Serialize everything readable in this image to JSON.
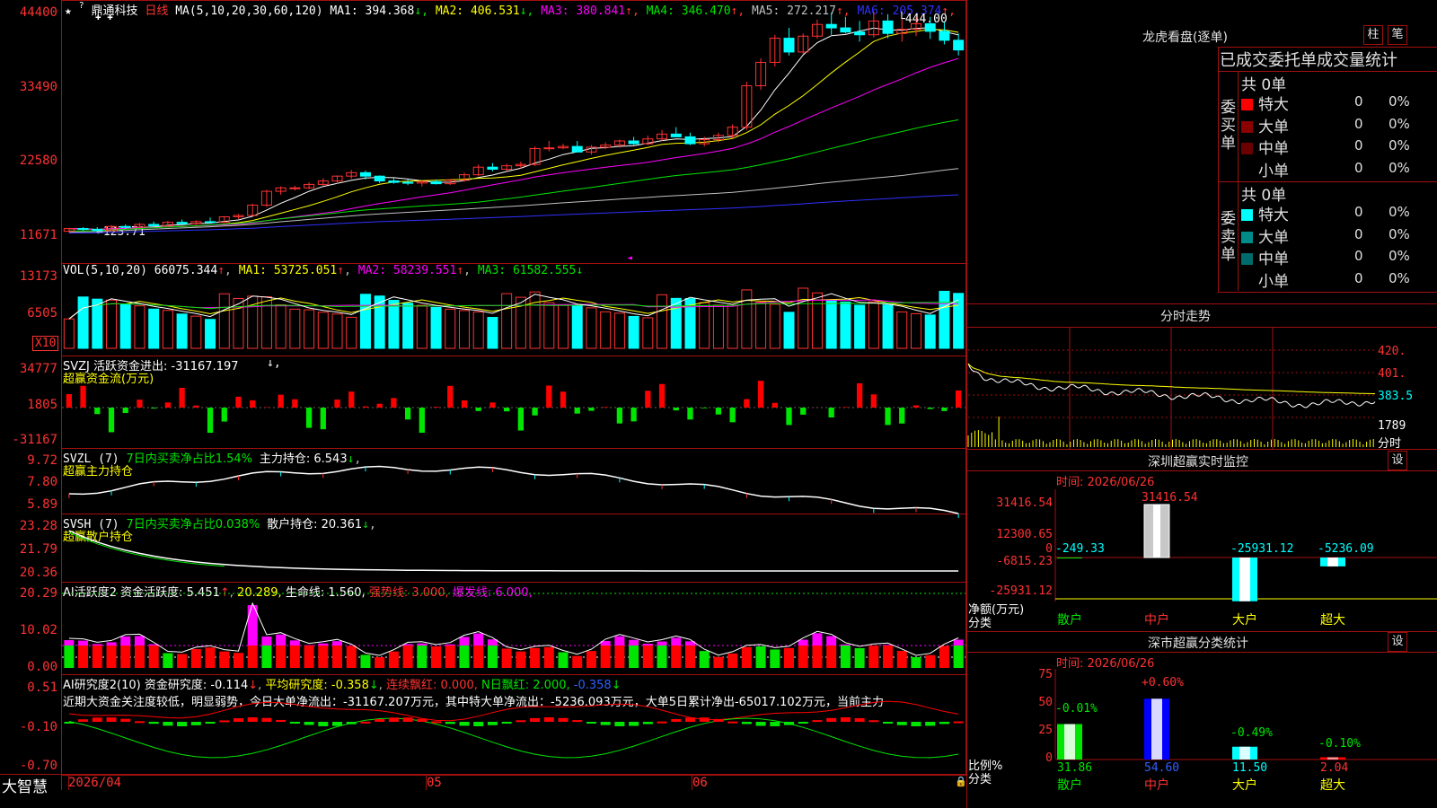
{
  "main": {
    "stock_name": "鼎通科技",
    "period": "日线",
    "ma_label": "MA(5,10,20,30,60,120)",
    "ma_values": [
      {
        "label": "MA1: 394.368",
        "arrow": "↓",
        "color": "#ffffff"
      },
      {
        "label": "MA2: 406.531",
        "arrow": "↓",
        "color": "#ffff00"
      },
      {
        "label": "MA3: 380.841",
        "arrow": "↑",
        "color": "#ff00ff"
      },
      {
        "label": "MA4: 346.470",
        "arrow": "↑",
        "color": "#00e600"
      },
      {
        "label": "MA5: 272.217",
        "arrow": "↑",
        "color": "#c0c0c0"
      },
      {
        "label": "MA6: 205.374",
        "arrow": "↑",
        "color": "#3030ff"
      }
    ],
    "y_labels": [
      "44400",
      "33490",
      "22580",
      "11671"
    ],
    "high_label": "444.00",
    "low_label": "123.71"
  },
  "vol": {
    "label": "VOL(5,10,20)",
    "value": "66075.344",
    "ma1": "MA1: 53725.051",
    "ma2": "MA2: 58239.551",
    "ma3": "MA3: 61582.555",
    "y_labels": [
      "13173",
      "6505"
    ],
    "unit": "X10"
  },
  "svzj": {
    "label": "SVZJ  活跃资金进出: -31167.197",
    "sub": "超赢资金流(万元)",
    "y_labels": [
      "34777",
      "1805",
      "-31167"
    ]
  },
  "svzl": {
    "label": "SVZL (7)",
    "info": "7日内买卖净占比1.54%",
    "hold": "主力持仓: 6.543",
    "sub": "超赢主力持仓",
    "y_labels": [
      "9.72",
      "7.80",
      "5.89"
    ]
  },
  "svsh": {
    "label": "SVSH (7)",
    "info": "7日内买卖净占比0.038%",
    "hold": "散户持仓: 20.361",
    "sub": "超赢散户持仓",
    "y_labels": [
      "23.28",
      "21.79",
      "20.36"
    ]
  },
  "ai1": {
    "label": "AI活跃度2",
    "v1": "资金活跃度: 5.451",
    "v2": "20.289,",
    "v3": "生命线: 1.560,",
    "v4": "强势线: 3.000,",
    "v5": "爆发线: 6.000,",
    "y_labels": [
      "20.29",
      "10.02",
      "0.00"
    ]
  },
  "ai2": {
    "label": "AI研究度2(10)",
    "v1": "资金研究度: -0.114",
    "v2": "平均研究度: -0.358",
    "v3": "连续飘红: 0.000,",
    "v4": "N日飘红: 2.000,",
    "v5": "-0.358",
    "desc": "近期大资金关注度较低，明显弱势，今日大单净流出：-31167.207万元，其中特大单净流出：-5236.093万元，大单5日累计净出-65017.102万元，当前主力",
    "y_labels": [
      "0.51",
      "-0.10",
      "-0.70"
    ]
  },
  "x_axis": {
    "labels": [
      "2026/04",
      "05",
      "06"
    ]
  },
  "brand": "大智慧",
  "right": {
    "lhkp_title": "龙虎看盘(逐单)",
    "btn1": "柱",
    "btn2": "笔",
    "tabs": "已成交委托单成交量统计",
    "buy_label": "委买单",
    "sell_label": "委卖单",
    "buy_total": "共 0单",
    "sell_total": "共 0单",
    "rows_buy": [
      {
        "name": "特大",
        "count": "0",
        "pct": "0%",
        "color": "#ff0000"
      },
      {
        "name": "大单",
        "count": "0",
        "pct": "0%",
        "color": "#8b0000"
      },
      {
        "name": "中单",
        "count": "0",
        "pct": "0%",
        "color": "#6b0000"
      },
      {
        "name": "小单",
        "count": "0",
        "pct": "0%",
        "color": "#000000"
      }
    ],
    "rows_sell": [
      {
        "name": "特大",
        "count": "0",
        "pct": "0%",
        "color": "#00ffff"
      },
      {
        "name": "大单",
        "count": "0",
        "pct": "0%",
        "color": "#008b8b"
      },
      {
        "name": "中单",
        "count": "0",
        "pct": "0%",
        "color": "#006b6b"
      },
      {
        "name": "小单",
        "count": "0",
        "pct": "0%",
        "color": "#000000"
      }
    ],
    "fenshi_title": "分时走势",
    "fenshi_prices": [
      "420.",
      "401.",
      "383.5"
    ],
    "fenshi_vol": "1789",
    "fenshi_unit": "分时",
    "sz_title": "深圳超赢实时监控",
    "sz_time": "时间: 2026/06/26",
    "sz_btn": "设",
    "sz_ylabels": [
      "31416.54",
      "12300.65",
      "0",
      "-6815.23",
      "-25931.12"
    ],
    "sz_axis_title1": "净额(万元)",
    "sz_axis_title2": "分类",
    "sz_values": [
      "-249.33",
      "31416.54",
      "-25931.12",
      "-5236.09"
    ],
    "sz_cats": [
      "散户",
      "中户",
      "大户",
      "超大"
    ],
    "ss_title": "深市超赢分类统计",
    "ss_time": "时间: 2026/06/26",
    "ss_btn": "设",
    "ss_ylabels": [
      "75",
      "50",
      "25",
      "0"
    ],
    "ss_axis_title1": "比例%",
    "ss_axis_title2": "分类",
    "ss_changes": [
      "-0.01%",
      "+0.60%",
      "-0.49%",
      "-0.10%"
    ],
    "ss_values": [
      "31.86",
      "54.60",
      "11.50",
      "2.04"
    ],
    "ss_cats": [
      "散户",
      "中户",
      "大户",
      "超大"
    ]
  },
  "chart_data": {
    "type": "candlestick",
    "title": "鼎通科技 日线",
    "ylim": [
      116.71,
      444.0
    ],
    "candles": [
      [
        125,
        130,
        123.7,
        129
      ],
      [
        129,
        131,
        126,
        128
      ],
      [
        128,
        131,
        125,
        126
      ],
      [
        126,
        134,
        125,
        132
      ],
      [
        132,
        135,
        129,
        131
      ],
      [
        131,
        137,
        130,
        135
      ],
      [
        135,
        139,
        133,
        133
      ],
      [
        133,
        140,
        131,
        138
      ],
      [
        138,
        142,
        135,
        136
      ],
      [
        136,
        141,
        134,
        139
      ],
      [
        139,
        145,
        137,
        138
      ],
      [
        138,
        147,
        137,
        146
      ],
      [
        146,
        150,
        143,
        148
      ],
      [
        148,
        165,
        147,
        163
      ],
      [
        163,
        185,
        160,
        183
      ],
      [
        183,
        190,
        178,
        188
      ],
      [
        188,
        191,
        184,
        188
      ],
      [
        188,
        196,
        186,
        193
      ],
      [
        193,
        202,
        191,
        198
      ],
      [
        198,
        206,
        194,
        205
      ],
      [
        205,
        214,
        201,
        210
      ],
      [
        210,
        213,
        200,
        205
      ],
      [
        205,
        206,
        195,
        198
      ],
      [
        198,
        202,
        194,
        196
      ],
      [
        196,
        200,
        192,
        195
      ],
      [
        195,
        199,
        190,
        197
      ],
      [
        197,
        200,
        193,
        194
      ],
      [
        194,
        201,
        192,
        199
      ],
      [
        199,
        210,
        197,
        207
      ],
      [
        207,
        222,
        205,
        218
      ],
      [
        218,
        224,
        212,
        215
      ],
      [
        215,
        223,
        213,
        220
      ],
      [
        220,
        226,
        216,
        222
      ],
      [
        222,
        248,
        220,
        245
      ],
      [
        245,
        256,
        241,
        246
      ],
      [
        246,
        252,
        244,
        248
      ],
      [
        248,
        256,
        243,
        240
      ],
      [
        240,
        250,
        236,
        247
      ],
      [
        247,
        254,
        244,
        250
      ],
      [
        250,
        258,
        246,
        256
      ],
      [
        256,
        262,
        250,
        252
      ],
      [
        252,
        264,
        250,
        259
      ],
      [
        259,
        272,
        256,
        266
      ],
      [
        266,
        276,
        262,
        262
      ],
      [
        262,
        268,
        250,
        252
      ],
      [
        252,
        262,
        248,
        258
      ],
      [
        258,
        268,
        254,
        264
      ],
      [
        264,
        280,
        260,
        276
      ],
      [
        276,
        342,
        272,
        336
      ],
      [
        336,
        376,
        330,
        370
      ],
      [
        370,
        410,
        364,
        405
      ],
      [
        405,
        420,
        380,
        385
      ],
      [
        385,
        412,
        382,
        408
      ],
      [
        408,
        432,
        404,
        425
      ],
      [
        425,
        442,
        410,
        420
      ],
      [
        420,
        436,
        412,
        414
      ],
      [
        414,
        430,
        400,
        410
      ],
      [
        410,
        444,
        406,
        430
      ],
      [
        430,
        440,
        405,
        412
      ],
      [
        412,
        432,
        400,
        418
      ],
      [
        418,
        436,
        408,
        426
      ],
      [
        426,
        436,
        404,
        415
      ],
      [
        415,
        428,
        396,
        402
      ],
      [
        402,
        412,
        380,
        388
      ]
    ],
    "vol_colors_up": true
  }
}
